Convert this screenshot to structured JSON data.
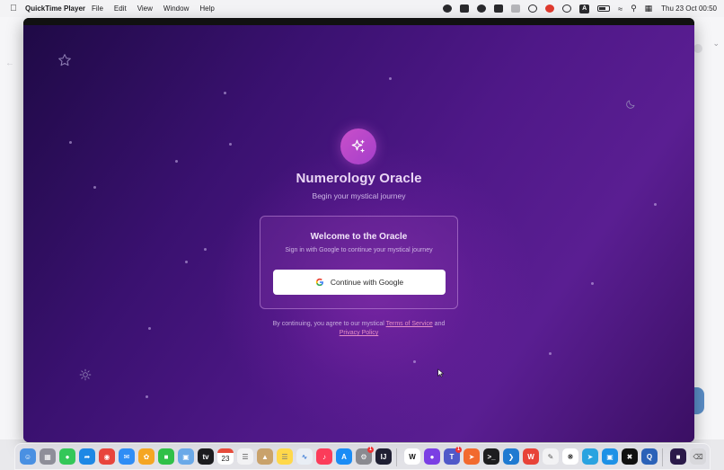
{
  "menubar": {
    "app_name": "QuickTime Player",
    "menus": [
      "File",
      "Edit",
      "View",
      "Window",
      "Help"
    ],
    "clock": "Thu 23 Oct  00:50",
    "status_a_label": "A"
  },
  "app": {
    "title": "Numerology Oracle",
    "subtitle": "Begin your mystical journey"
  },
  "card": {
    "title": "Welcome to the Oracle",
    "subtitle": "Sign in with Google to continue your mystical journey",
    "google_button_label": "Continue with Google"
  },
  "legal": {
    "prefix": "By continuing, you agree to our mystical",
    "terms_link": "Terms of Service",
    "conjunction": "and",
    "privacy_link": "Privacy Policy"
  },
  "dock": {
    "calendar_day": "23",
    "badge_settings": "1",
    "badge_teams": "1"
  },
  "colors": {
    "accent": "#c94fc9",
    "link": "#e58ec6",
    "background_deep": "#1f0a46",
    "background_mid": "#4f1888"
  }
}
